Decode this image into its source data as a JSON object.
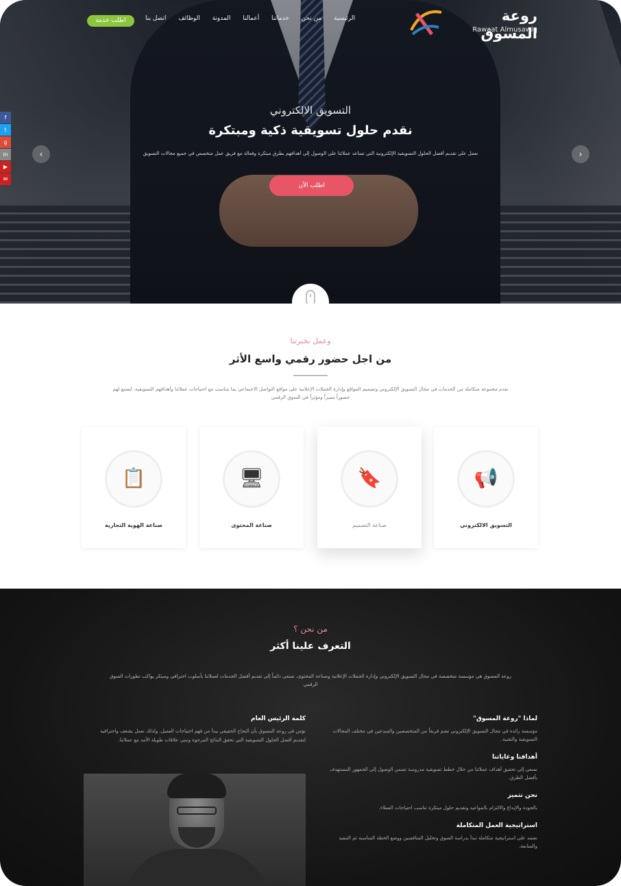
{
  "brand": {
    "name": "روعة المسوق",
    "sub": "Rawaat Almusawiq",
    "colors": {
      "accent": "#e85567",
      "green": "#8cc63f",
      "pink": "#e28b9b"
    }
  },
  "nav": {
    "links": [
      "الرئيسية",
      "من نحن",
      "خدماتنا",
      "أعمالنا",
      "المدونة",
      "الوظائف",
      "اتصل بنا"
    ],
    "cta": "اطلب خدمة"
  },
  "social": [
    {
      "icon": "facebook-icon",
      "glyph": "f",
      "color": "#3b5998"
    },
    {
      "icon": "twitter-icon",
      "glyph": "t",
      "color": "#1da1f2"
    },
    {
      "icon": "google-plus-icon",
      "glyph": "g",
      "color": "#dd4b39"
    },
    {
      "icon": "linkedin-icon",
      "glyph": "in",
      "color": "#888888"
    },
    {
      "icon": "youtube-icon",
      "glyph": "▶",
      "color": "#cd201f"
    },
    {
      "icon": "email-icon",
      "glyph": "✉",
      "color": "#cd201f"
    }
  ],
  "hero": {
    "kicker": "التسويق الالكتروني",
    "title": "نقدم حلول تسويقية ذكية ومبتكرة",
    "desc": "نعمل على تقديم أفضل الحلول التسويقية الإلكترونية التي تساعد عملائنا على الوصول إلى أهدافهم بطرق مبتكرة وفعالة مع فريق عمل متخصص في جميع مجالات التسويق",
    "button": "اطلب الآن"
  },
  "services": {
    "kicker": "وعمل بخبرتنا",
    "title": "من اجل حضور رقمي واسع الأثر",
    "desc": "نقدم مجموعة متكاملة من الخدمات في مجال التسويق الإلكتروني وتصميم المواقع وإدارة الحملات الإعلانية على مواقع التواصل الاجتماعي بما يتناسب مع احتياجات عملائنا وأهدافهم التسويقية، لنصنع لهم حضوراً مميزاً ومؤثراً في السوق الرقمي",
    "cards": [
      {
        "label": "صناعة الهوية التجارية",
        "glyph": "📋"
      },
      {
        "label": "صناعة المحتوى",
        "glyph": "🖥"
      },
      {
        "label": "صناعة التصميم",
        "glyph": "🔖"
      },
      {
        "label": "التسويق الالكتروني",
        "glyph": "📢"
      }
    ]
  },
  "about": {
    "kicker": "من نحن ؟",
    "title": "التعرف علينا أكثر",
    "desc": "روعة المسوق هي مؤسسة متخصصة في مجال التسويق الإلكتروني وإدارة الحملات الإعلانية وصناعة المحتوى، نسعى دائماً إلى تقديم أفضل الخدمات لعملائنا بأسلوب احترافي ومبتكر يواكب تطورات السوق الرقمي",
    "items": [
      {
        "title": "لماذا \"روعة المسوق\"",
        "text": "مؤسسة رائدة في مجال التسويق الإلكتروني تضم فريقاً من المتخصصين والمبدعين في مختلف المجالات التسويقية والتقنية."
      },
      {
        "title": "أهدافنا وغاياتنا",
        "text": "نسعى إلى تحقيق أهداف عملائنا من خلال خطط تسويقية مدروسة تضمن الوصول إلى الجمهور المستهدف بأفضل الطرق."
      },
      {
        "title": "نحن نتميز",
        "text": "بالجودة والإبداع والالتزام بالمواعيد وتقديم حلول مبتكرة تناسب احتياجات العملاء."
      },
      {
        "title": "استراتيجية العمل المتكاملة",
        "text": "نعتمد على استراتيجية متكاملة تبدأ بدراسة السوق وتحليل المنافسين ووضع الخطة المناسبة ثم التنفيذ والمتابعة."
      }
    ],
    "team": {
      "title": "كلمة الرئيس العام",
      "text": "نؤمن في روعة المسوق بأن النجاح الحقيقي يبدأ من فهم احتياجات العميل، ولذلك نعمل بشغف واحترافية لتقديم أفضل الحلول التسويقية التي تحقق النتائج المرجوة وتبني علاقات طويلة الأمد مع عملائنا."
    }
  }
}
